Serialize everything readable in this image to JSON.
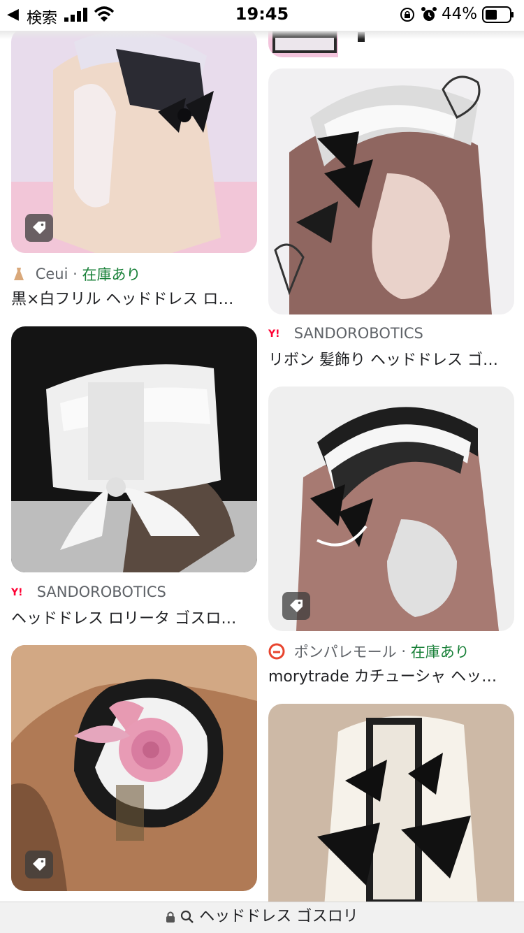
{
  "status_bar": {
    "back_app": "検索",
    "time": "19:45",
    "battery": "44%"
  },
  "url_bar": {
    "query": "ヘッドドレス ゴスロリ"
  },
  "results": {
    "left": [
      {
        "source": "Ceui",
        "separator": "·",
        "stock": "在庫あり",
        "title": "黒×白フリル ヘッドドレス ロ…",
        "has_tag": true,
        "source_icon": "dress-icon"
      },
      {
        "source": "SANDOROBOTICS",
        "title": "ヘッドドレス ロリータ ゴスロ…",
        "has_tag": false,
        "source_icon": "yahoo-icon"
      },
      {
        "source": "",
        "title": "",
        "has_tag": true
      }
    ],
    "right": [
      {
        "title": "",
        "has_tag": false
      },
      {
        "source": "SANDOROBOTICS",
        "title": "リボン 髪飾り ヘッドドレス ゴ…",
        "has_tag": false,
        "source_icon": "yahoo-icon"
      },
      {
        "source": "ポンパレモール",
        "separator": "·",
        "stock": "在庫あり",
        "title": "morytrade カチューシャ ヘッ…",
        "has_tag": true,
        "source_icon": "ponpare-icon"
      },
      {
        "source": "",
        "title": "",
        "has_tag": false
      }
    ]
  },
  "colors": {
    "in_stock": "#188038",
    "source_text": "#5f6368",
    "yahoo_red": "#ff0033",
    "ponpare_red": "#e8442e"
  }
}
